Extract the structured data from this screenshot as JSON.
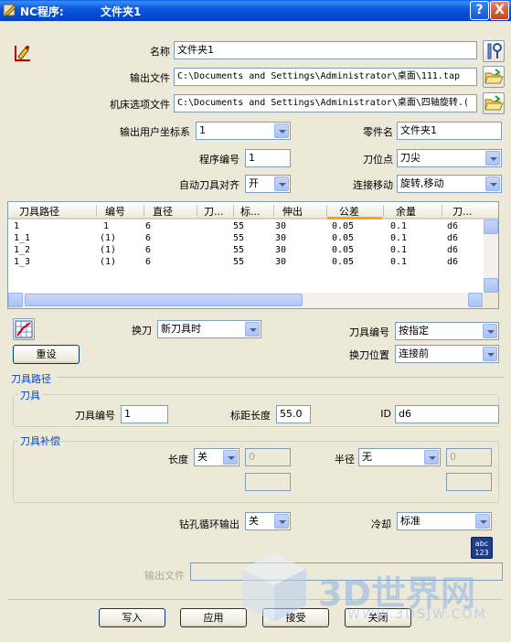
{
  "window": {
    "title_app": "NC程序:",
    "title_folder": "文件夹1",
    "help_label": "?",
    "close_label": "X"
  },
  "form": {
    "name_label": "名称",
    "name_value": "文件夹1",
    "output_file_label": "输出文件",
    "output_file_value": "C:\\Documents and Settings\\Administrator\\桌面\\111.tap",
    "machine_option_label": "机床选项文件",
    "machine_option_value": "C:\\Documents and Settings\\Administrator\\桌面\\四轴旋转.(",
    "user_coord_label": "输出用户坐标系",
    "user_coord_value": "1",
    "part_name_label": "零件名",
    "part_name_value": "文件夹1",
    "program_no_label": "程序编号",
    "program_no_value": "1",
    "tool_point_label": "刀位点",
    "tool_point_value": "刀尖",
    "auto_align_label": "自动刀具对齐",
    "auto_align_value": "开",
    "link_move_label": "连接移动",
    "link_move_value": "旋转,移动"
  },
  "table": {
    "columns": [
      "刀具路径",
      "编号",
      "直径",
      "刀...",
      "标...",
      "伸出",
      "公差",
      "余量",
      "刀..."
    ],
    "rows": [
      [
        "1",
        "1",
        "6",
        "",
        "55",
        "30",
        "0.05",
        "0.1",
        "d6"
      ],
      [
        "1_1",
        "(1)",
        "6",
        "",
        "55",
        "30",
        "0.05",
        "0.1",
        "d6"
      ],
      [
        "1_2",
        "(1)",
        "6",
        "",
        "55",
        "30",
        "0.05",
        "0.1",
        "d6"
      ],
      [
        "1_3",
        "(1)",
        "6",
        "",
        "55",
        "30",
        "0.05",
        "0.1",
        "d6"
      ]
    ]
  },
  "toolchange": {
    "change_label": "换刀",
    "change_value": "新刀具时",
    "tool_no_label": "刀具编号",
    "tool_no_value": "按指定",
    "change_pos_label": "换刀位置",
    "change_pos_value": "连接前",
    "reset_label": "重设"
  },
  "toolpath_section": {
    "title": "刀具路径",
    "tool_group": "刀具",
    "tool_no_label": "刀具编号",
    "tool_no_value": "1",
    "gauge_len_label": "标距长度",
    "gauge_len_value": "55.0",
    "id_label": "ID",
    "id_value": "d6",
    "comp_group": "刀具补偿",
    "length_label": "长度",
    "length_value": "关",
    "length_num": "0",
    "radius_label": "半径",
    "radius_value": "无",
    "radius_num": "0"
  },
  "bottom": {
    "drill_label": "钻孔循环输出",
    "drill_value": "关",
    "coolant_label": "冷却",
    "coolant_value": "标准",
    "abc_label": "abc",
    "abc_sub": "123",
    "output_file_label": "输出文件"
  },
  "buttons": {
    "write": "写入",
    "apply": "应用",
    "accept": "接受",
    "cancel": "关闭"
  },
  "watermark": {
    "brand": "3D世界网",
    "url": "WWW.3DSJW.COM"
  }
}
